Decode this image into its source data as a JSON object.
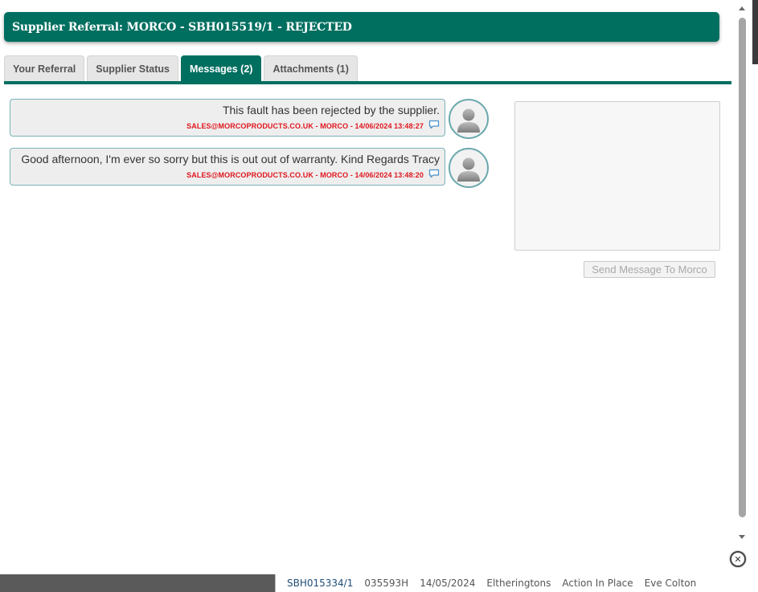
{
  "dialog": {
    "title": "Supplier Referral: MORCO - SBH015519/1 - REJECTED"
  },
  "tabs": [
    {
      "label": "Your Referral",
      "active": false
    },
    {
      "label": "Supplier Status",
      "active": false
    },
    {
      "label": "Messages (2)",
      "active": true
    },
    {
      "label": "Attachments (1)",
      "active": false
    }
  ],
  "messages": [
    {
      "text": "This fault has been rejected by the supplier.",
      "meta": "SALES@MORCOPRODUCTS.CO.UK - MORCO - 14/06/2024 13:48:27",
      "icon": "reply-speech-bubble-icon"
    },
    {
      "text": "Good afternoon, I'm ever so sorry but this is out out of warranty. Kind Regards Tracy",
      "meta": "SALES@MORCOPRODUCTS.CO.UK - MORCO - 14/06/2024 13:48:20",
      "icon": "reply-speech-bubble-icon"
    }
  ],
  "compose": {
    "value": "",
    "send_label": "Send Message To Morco"
  },
  "background_row": {
    "ref": "SBH015334/1",
    "code": "035593H",
    "date": "14/05/2024",
    "site": "Eltheringtons",
    "status": "Action In Place",
    "person": "Eve Colton"
  },
  "colors": {
    "brand": "#006f60",
    "meta_red": "#e0161e",
    "bubble_border": "#7ab3b8"
  },
  "icons": {
    "close": "close-icon",
    "avatar": "user-avatar-icon"
  }
}
